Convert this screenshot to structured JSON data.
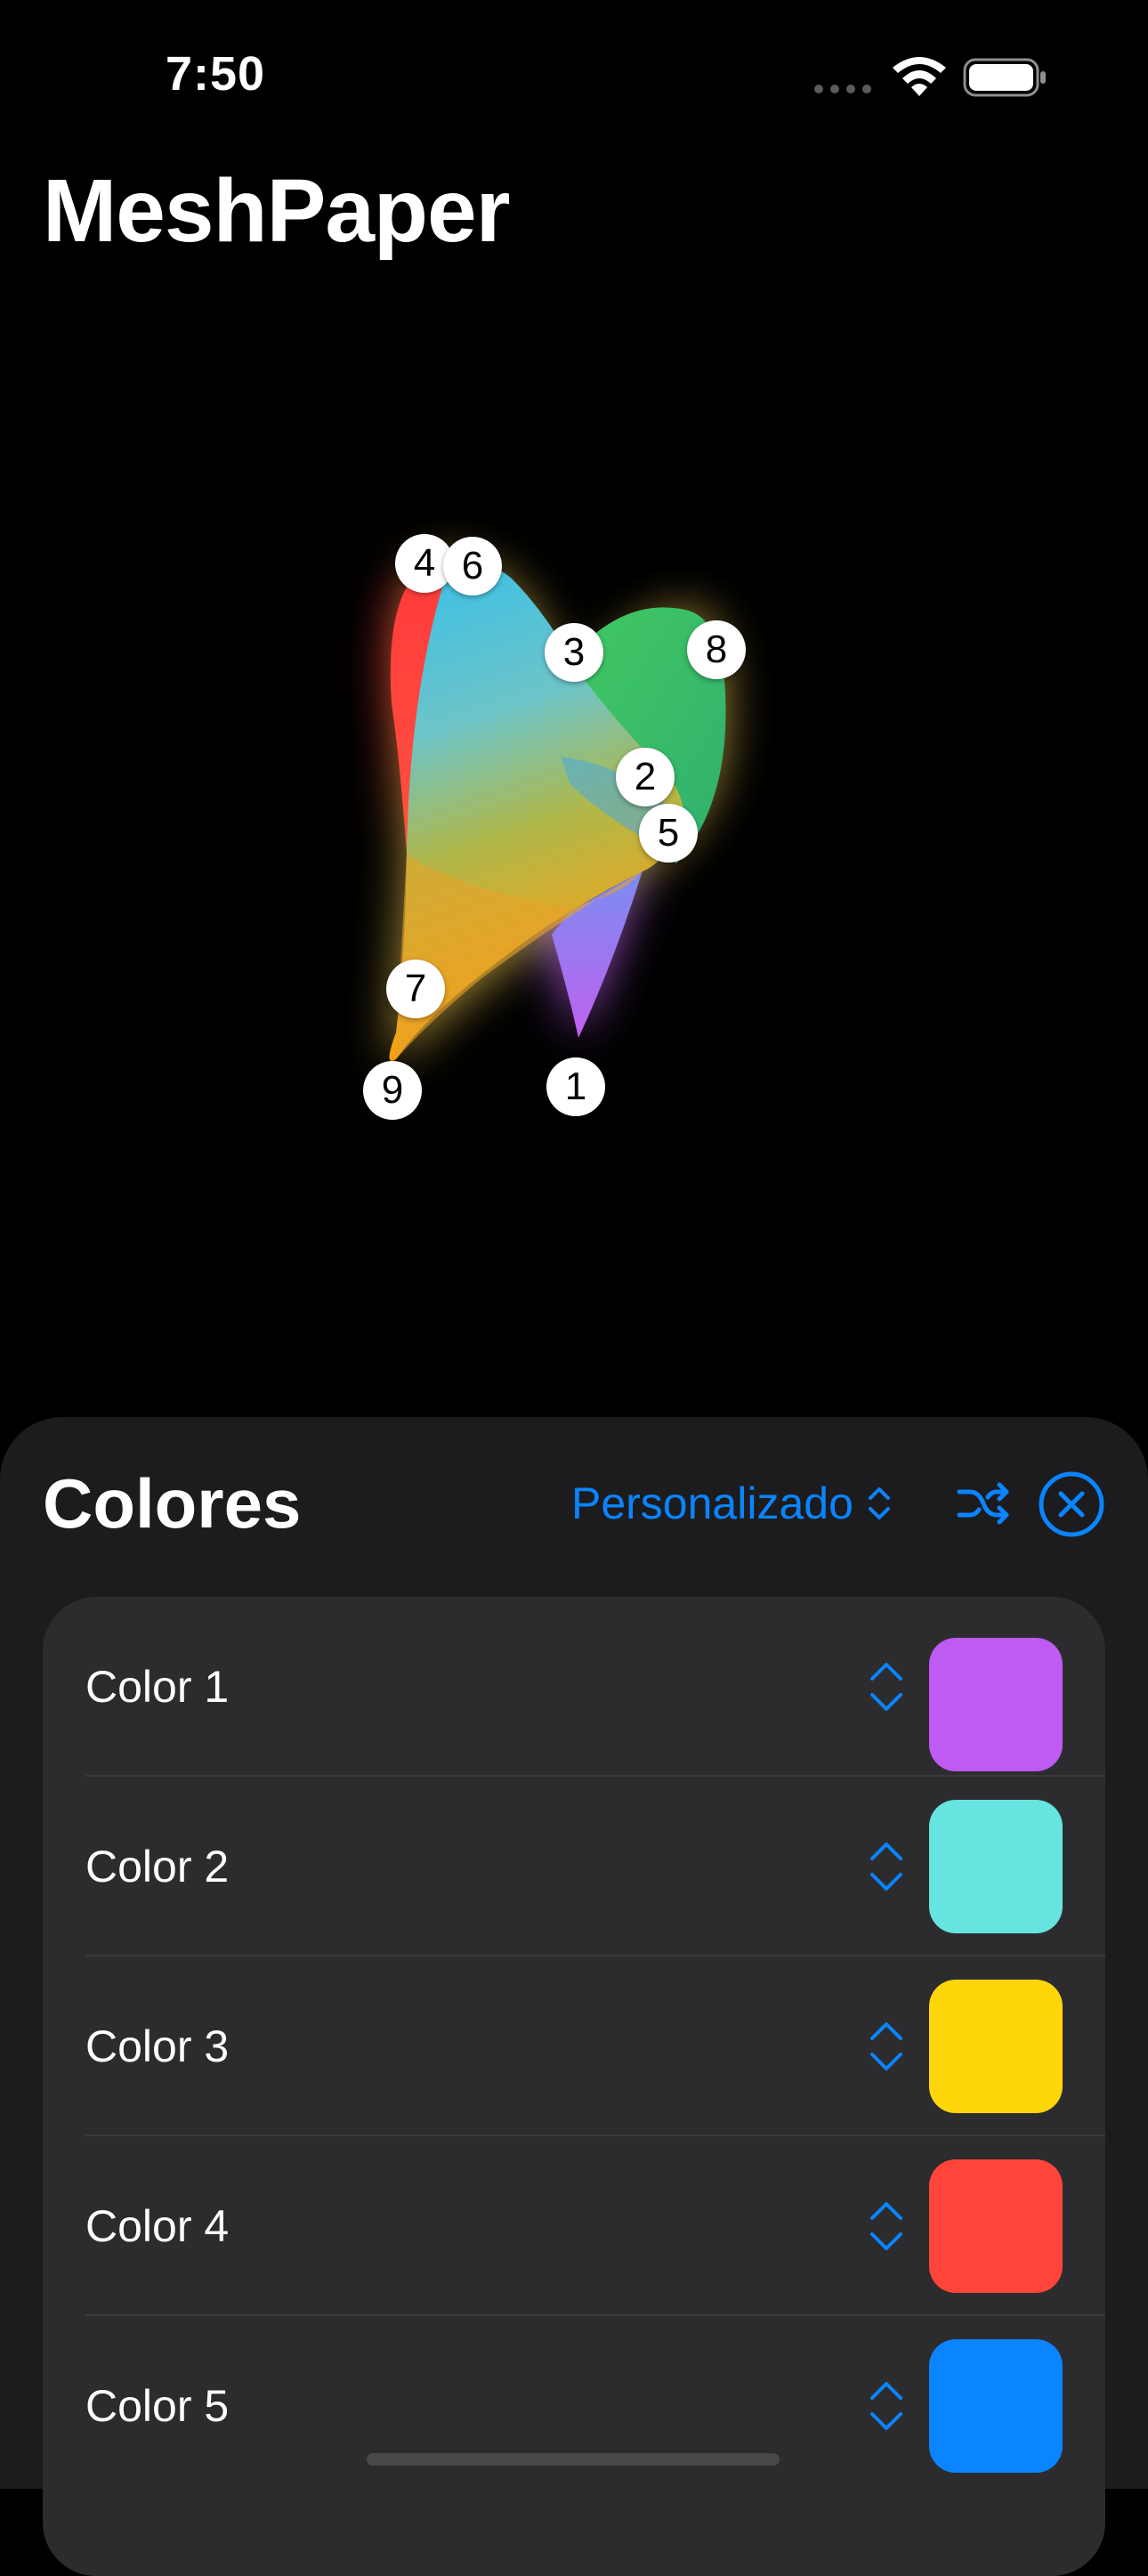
{
  "status_bar": {
    "time": "7:50"
  },
  "app": {
    "title": "MeshPaper"
  },
  "mesh": {
    "handles": [
      "4",
      "6",
      "3",
      "8",
      "2",
      "5",
      "7",
      "9",
      "1"
    ]
  },
  "sheet": {
    "title": "Colores",
    "preset_label": "Personalizado",
    "accent_color": "#0a84ff",
    "colors": [
      {
        "label": "Color 1",
        "swatch": "#bf5af2"
      },
      {
        "label": "Color 2",
        "swatch": "#66e4df"
      },
      {
        "label": "Color 3",
        "swatch": "#ffd60a"
      },
      {
        "label": "Color 4",
        "swatch": "#ff453a"
      },
      {
        "label": "Color 5",
        "swatch": "#0a84ff"
      }
    ]
  }
}
